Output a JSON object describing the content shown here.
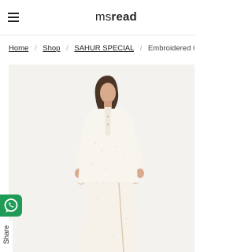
{
  "header": {
    "logo_light": "ms",
    "logo_bold": "read",
    "menu_icon": "hamburger-menu-icon"
  },
  "breadcrumb": {
    "items": [
      "Home",
      "Shop",
      "SAHUR SPECIAL"
    ],
    "current": "Embroidered Overlap"
  },
  "product": {
    "image_icon": "product-photo"
  },
  "floating": {
    "whatsapp_icon": "whatsapp-icon",
    "share_label": "Share"
  },
  "colors": {
    "accent_green": "#1f9a57",
    "background": "#ffffff",
    "image_backdrop": "#f3f2ef"
  }
}
